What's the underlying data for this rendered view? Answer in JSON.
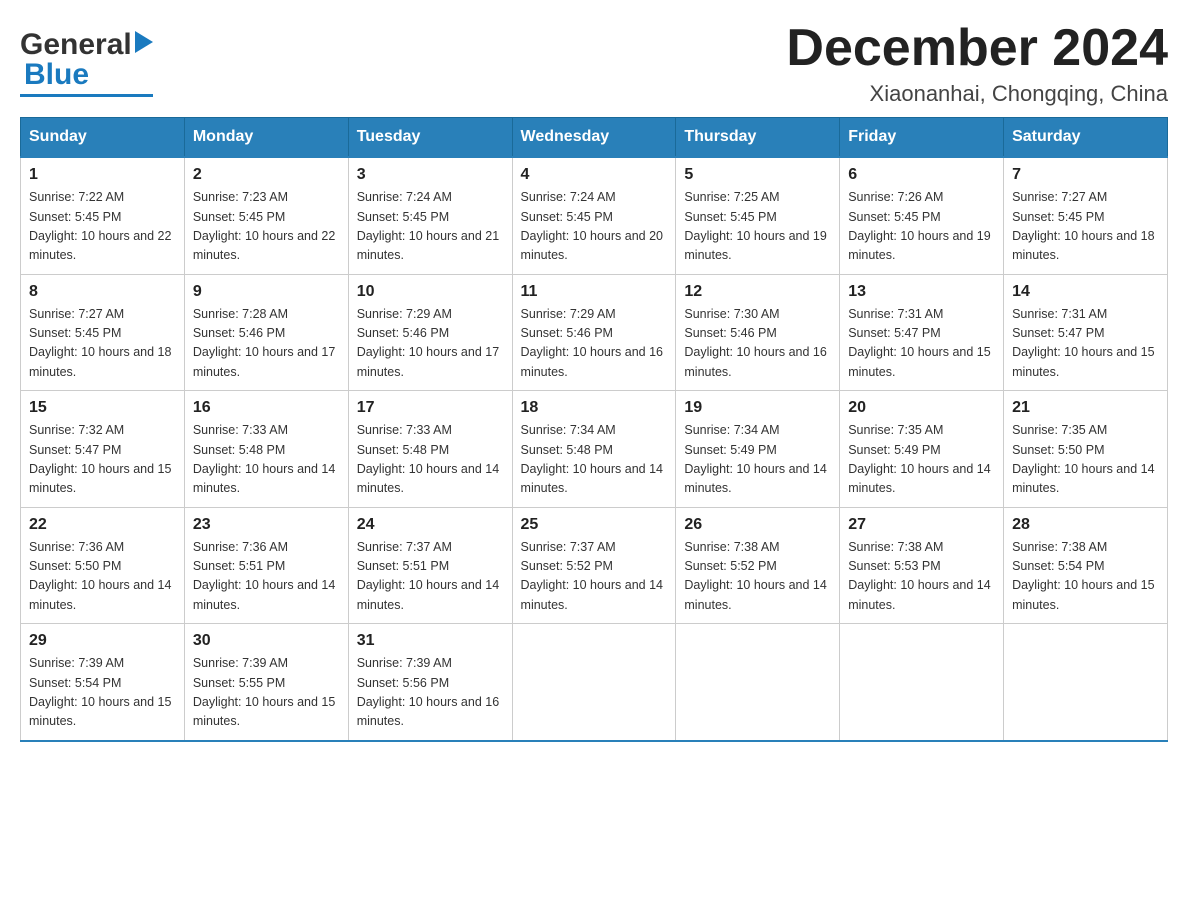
{
  "header": {
    "logo_general": "General",
    "logo_blue": "Blue",
    "month_title": "December 2024",
    "location": "Xiaonanhai, Chongqing, China"
  },
  "days_of_week": [
    "Sunday",
    "Monday",
    "Tuesday",
    "Wednesday",
    "Thursday",
    "Friday",
    "Saturday"
  ],
  "weeks": [
    [
      {
        "day": "1",
        "sunrise": "7:22 AM",
        "sunset": "5:45 PM",
        "daylight": "10 hours and 22 minutes."
      },
      {
        "day": "2",
        "sunrise": "7:23 AM",
        "sunset": "5:45 PM",
        "daylight": "10 hours and 22 minutes."
      },
      {
        "day": "3",
        "sunrise": "7:24 AM",
        "sunset": "5:45 PM",
        "daylight": "10 hours and 21 minutes."
      },
      {
        "day": "4",
        "sunrise": "7:24 AM",
        "sunset": "5:45 PM",
        "daylight": "10 hours and 20 minutes."
      },
      {
        "day": "5",
        "sunrise": "7:25 AM",
        "sunset": "5:45 PM",
        "daylight": "10 hours and 19 minutes."
      },
      {
        "day": "6",
        "sunrise": "7:26 AM",
        "sunset": "5:45 PM",
        "daylight": "10 hours and 19 minutes."
      },
      {
        "day": "7",
        "sunrise": "7:27 AM",
        "sunset": "5:45 PM",
        "daylight": "10 hours and 18 minutes."
      }
    ],
    [
      {
        "day": "8",
        "sunrise": "7:27 AM",
        "sunset": "5:45 PM",
        "daylight": "10 hours and 18 minutes."
      },
      {
        "day": "9",
        "sunrise": "7:28 AM",
        "sunset": "5:46 PM",
        "daylight": "10 hours and 17 minutes."
      },
      {
        "day": "10",
        "sunrise": "7:29 AM",
        "sunset": "5:46 PM",
        "daylight": "10 hours and 17 minutes."
      },
      {
        "day": "11",
        "sunrise": "7:29 AM",
        "sunset": "5:46 PM",
        "daylight": "10 hours and 16 minutes."
      },
      {
        "day": "12",
        "sunrise": "7:30 AM",
        "sunset": "5:46 PM",
        "daylight": "10 hours and 16 minutes."
      },
      {
        "day": "13",
        "sunrise": "7:31 AM",
        "sunset": "5:47 PM",
        "daylight": "10 hours and 15 minutes."
      },
      {
        "day": "14",
        "sunrise": "7:31 AM",
        "sunset": "5:47 PM",
        "daylight": "10 hours and 15 minutes."
      }
    ],
    [
      {
        "day": "15",
        "sunrise": "7:32 AM",
        "sunset": "5:47 PM",
        "daylight": "10 hours and 15 minutes."
      },
      {
        "day": "16",
        "sunrise": "7:33 AM",
        "sunset": "5:48 PM",
        "daylight": "10 hours and 14 minutes."
      },
      {
        "day": "17",
        "sunrise": "7:33 AM",
        "sunset": "5:48 PM",
        "daylight": "10 hours and 14 minutes."
      },
      {
        "day": "18",
        "sunrise": "7:34 AM",
        "sunset": "5:48 PM",
        "daylight": "10 hours and 14 minutes."
      },
      {
        "day": "19",
        "sunrise": "7:34 AM",
        "sunset": "5:49 PM",
        "daylight": "10 hours and 14 minutes."
      },
      {
        "day": "20",
        "sunrise": "7:35 AM",
        "sunset": "5:49 PM",
        "daylight": "10 hours and 14 minutes."
      },
      {
        "day": "21",
        "sunrise": "7:35 AM",
        "sunset": "5:50 PM",
        "daylight": "10 hours and 14 minutes."
      }
    ],
    [
      {
        "day": "22",
        "sunrise": "7:36 AM",
        "sunset": "5:50 PM",
        "daylight": "10 hours and 14 minutes."
      },
      {
        "day": "23",
        "sunrise": "7:36 AM",
        "sunset": "5:51 PM",
        "daylight": "10 hours and 14 minutes."
      },
      {
        "day": "24",
        "sunrise": "7:37 AM",
        "sunset": "5:51 PM",
        "daylight": "10 hours and 14 minutes."
      },
      {
        "day": "25",
        "sunrise": "7:37 AM",
        "sunset": "5:52 PM",
        "daylight": "10 hours and 14 minutes."
      },
      {
        "day": "26",
        "sunrise": "7:38 AM",
        "sunset": "5:52 PM",
        "daylight": "10 hours and 14 minutes."
      },
      {
        "day": "27",
        "sunrise": "7:38 AM",
        "sunset": "5:53 PM",
        "daylight": "10 hours and 14 minutes."
      },
      {
        "day": "28",
        "sunrise": "7:38 AM",
        "sunset": "5:54 PM",
        "daylight": "10 hours and 15 minutes."
      }
    ],
    [
      {
        "day": "29",
        "sunrise": "7:39 AM",
        "sunset": "5:54 PM",
        "daylight": "10 hours and 15 minutes."
      },
      {
        "day": "30",
        "sunrise": "7:39 AM",
        "sunset": "5:55 PM",
        "daylight": "10 hours and 15 minutes."
      },
      {
        "day": "31",
        "sunrise": "7:39 AM",
        "sunset": "5:56 PM",
        "daylight": "10 hours and 16 minutes."
      },
      null,
      null,
      null,
      null
    ]
  ],
  "sunrise_label": "Sunrise:",
  "sunset_label": "Sunset:",
  "daylight_label": "Daylight:"
}
